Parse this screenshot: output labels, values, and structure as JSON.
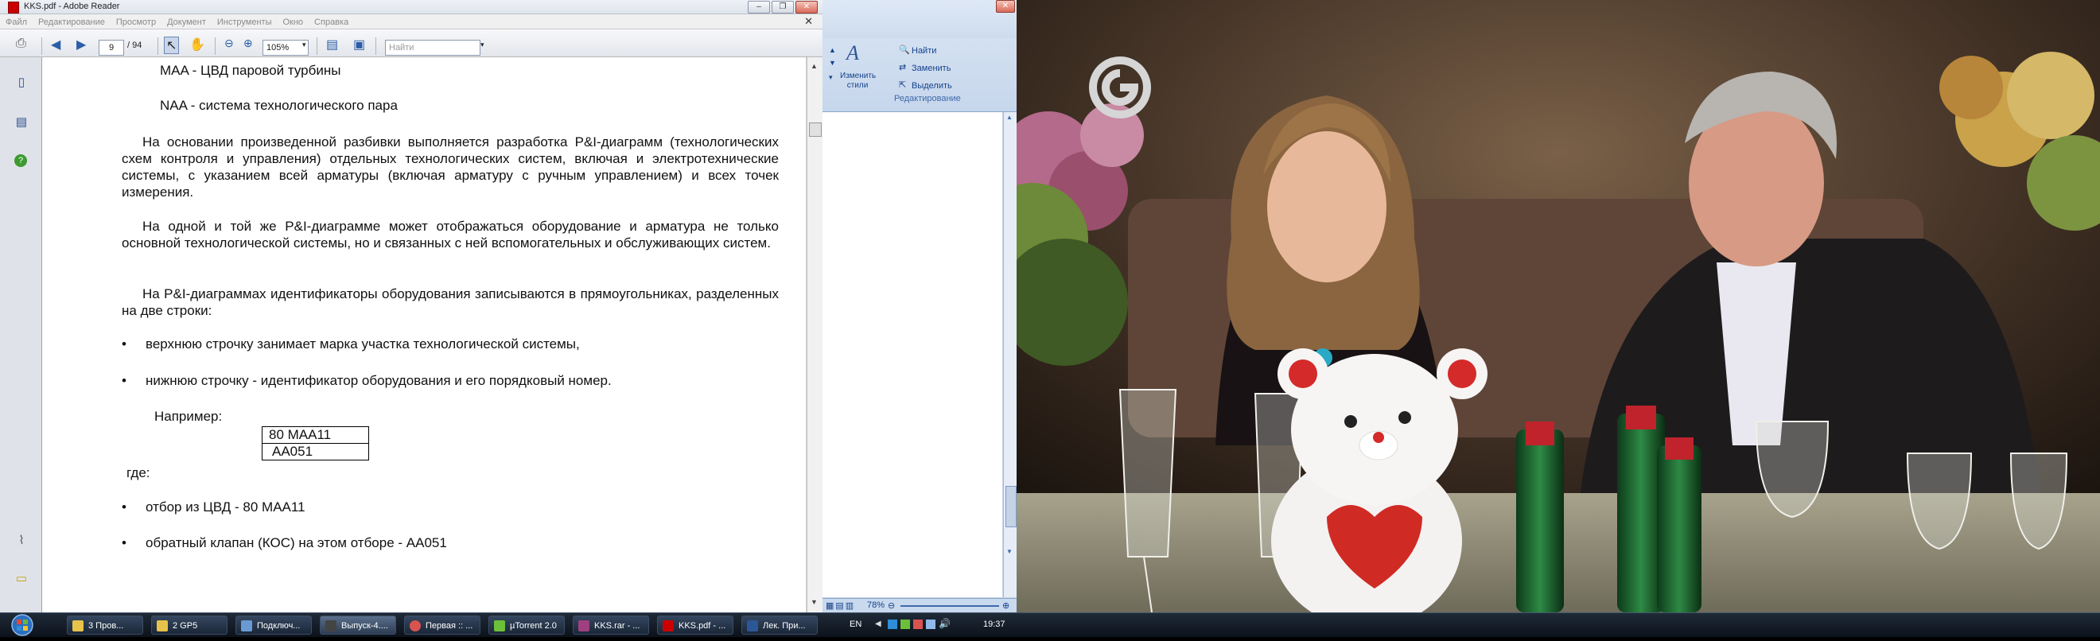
{
  "reader": {
    "title": "KKS.pdf - Adobe Reader",
    "menu": [
      "Файл",
      "Редактирование",
      "Просмотр",
      "Документ",
      "Инструменты",
      "Окно",
      "Справка"
    ],
    "toolbar": {
      "page_value": "9",
      "page_total": "/ 94",
      "zoom": "105%",
      "search_placeholder": "Найти"
    },
    "doc": {
      "line1": "MAA - ЦВД паровой турбины",
      "line2": "NAA - система технологического пара",
      "para1": "На основании произведенной разбивки выполняется разработка P&I-диаграмм (технологических схем контроля и управления) отдельных технологических систем, включая и электротехнические системы, с указанием всей арматуры (включая арматуру с ручным управлением) и всех точек измерения.",
      "para2": "На одной и той же P&I-диаграмме может отображаться оборудование и арматура не только основной технологической системы, но и связанных с ней вспомогательных и обслуживающих систем.",
      "para3": "На P&I-диаграммах идентификаторы оборудования записываются в прямоугольниках, разделенных на две строки:",
      "bullet1": "верхнюю строчку занимает марка участка технологической системы,",
      "bullet2": "нижнюю строчку - идентификатор оборудования и его порядковый номер.",
      "example_label": "Например:",
      "box_top": "80 MAA11",
      "box_bottom": "AA051",
      "where": "где:",
      "bullet3": "отбор из ЦВД - 80 MAA11",
      "bullet4": "обратный клапан (КОС) на этом отборе - AA051"
    }
  },
  "word": {
    "find": "Найти",
    "replace": "Заменить",
    "select": "Выделить",
    "change_styles": "Изменить стили",
    "group_label": "Редактирование",
    "zoom": "78%"
  },
  "taskbar": {
    "items": [
      {
        "label": "3 Пров...",
        "color": "#e8c34a"
      },
      {
        "label": "2 GP5",
        "color": "#e8c34a"
      },
      {
        "label": "Подключ...",
        "color": "#6a9ad4"
      },
      {
        "label": "Выпуск-4....",
        "color": "#444444"
      },
      {
        "label": "Первая :: ...",
        "color": "#d9534f"
      },
      {
        "label": "µTorrent 2.0",
        "color": "#6bbf3a"
      },
      {
        "label": "KKS.rar - ...",
        "color": "#a04080"
      },
      {
        "label": "KKS.pdf - ...",
        "color": "#cc0000"
      },
      {
        "label": "Лек. При...",
        "color": "#2b5797"
      }
    ],
    "lang": "EN",
    "clock": "19:37"
  }
}
